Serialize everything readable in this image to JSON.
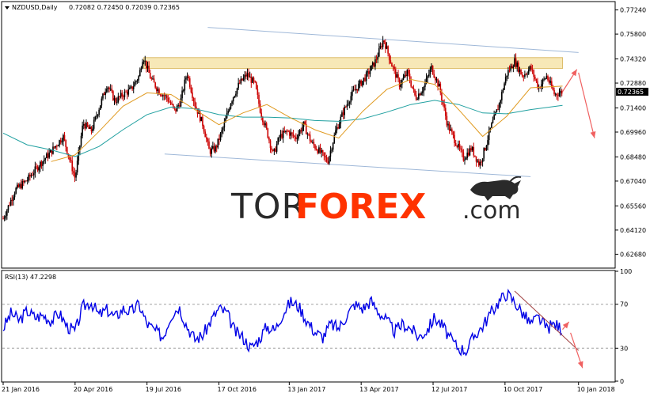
{
  "chart_data": [
    {
      "type": "candlestick",
      "title": "NZDUSD,Daily",
      "ohlc_values": "0.72082 0.72450 0.72039 0.72365",
      "last_price": "0.72365",
      "ylim": [
        0.619,
        0.7769
      ],
      "y_ticks": [
        "0.77240",
        "0.75800",
        "0.74320",
        "0.72880",
        "0.71400",
        "0.69960",
        "0.68480",
        "0.67040",
        "0.65560",
        "0.64120",
        "0.62680"
      ],
      "x_ticks": [
        "21 Jan 2016",
        "20 Apr 2016",
        "19 Jul 2016",
        "17 Oct 2016",
        "13 Jan 2017",
        "13 Apr 2017",
        "12 Jul 2017",
        "10 Oct 2017",
        "10 Jan 2018"
      ],
      "x_tick_days": [
        0,
        90,
        180,
        270,
        358,
        448,
        538,
        628,
        720
      ],
      "price_path": [
        [
          0,
          0.648
        ],
        [
          15,
          0.665
        ],
        [
          30,
          0.671
        ],
        [
          45,
          0.68
        ],
        [
          60,
          0.688
        ],
        [
          75,
          0.697
        ],
        [
          90,
          0.672
        ],
        [
          100,
          0.705
        ],
        [
          110,
          0.7
        ],
        [
          120,
          0.714
        ],
        [
          130,
          0.728
        ],
        [
          140,
          0.718
        ],
        [
          150,
          0.722
        ],
        [
          160,
          0.725
        ],
        [
          170,
          0.733
        ],
        [
          175,
          0.745
        ],
        [
          185,
          0.731
        ],
        [
          195,
          0.724
        ],
        [
          205,
          0.72
        ],
        [
          215,
          0.712
        ],
        [
          222,
          0.718
        ],
        [
          230,
          0.735
        ],
        [
          240,
          0.716
        ],
        [
          250,
          0.704
        ],
        [
          258,
          0.688
        ],
        [
          266,
          0.69
        ],
        [
          276,
          0.703
        ],
        [
          285,
          0.718
        ],
        [
          295,
          0.728
        ],
        [
          305,
          0.734
        ],
        [
          315,
          0.728
        ],
        [
          322,
          0.712
        ],
        [
          330,
          0.7
        ],
        [
          338,
          0.686
        ],
        [
          346,
          0.697
        ],
        [
          356,
          0.7
        ],
        [
          366,
          0.696
        ],
        [
          376,
          0.704
        ],
        [
          386,
          0.693
        ],
        [
          396,
          0.688
        ],
        [
          406,
          0.682
        ],
        [
          416,
          0.7
        ],
        [
          426,
          0.712
        ],
        [
          436,
          0.722
        ],
        [
          446,
          0.728
        ],
        [
          456,
          0.734
        ],
        [
          466,
          0.742
        ],
        [
          476,
          0.755
        ],
        [
          486,
          0.74
        ],
        [
          496,
          0.728
        ],
        [
          506,
          0.735
        ],
        [
          516,
          0.72
        ],
        [
          526,
          0.726
        ],
        [
          536,
          0.738
        ],
        [
          546,
          0.726
        ],
        [
          556,
          0.704
        ],
        [
          566,
          0.694
        ],
        [
          576,
          0.684
        ],
        [
          586,
          0.69
        ],
        [
          596,
          0.68
        ],
        [
          603,
          0.69
        ],
        [
          610,
          0.702
        ],
        [
          620,
          0.715
        ],
        [
          630,
          0.734
        ],
        [
          640,
          0.742
        ],
        [
          650,
          0.733
        ],
        [
          660,
          0.738
        ],
        [
          670,
          0.726
        ],
        [
          680,
          0.733
        ],
        [
          690,
          0.722
        ],
        [
          700,
          0.7237
        ]
      ],
      "ma_slow": [
        [
          0,
          0.699
        ],
        [
          30,
          0.692
        ],
        [
          60,
          0.689
        ],
        [
          90,
          0.685
        ],
        [
          120,
          0.691
        ],
        [
          150,
          0.701
        ],
        [
          180,
          0.71
        ],
        [
          210,
          0.7145
        ],
        [
          240,
          0.7135
        ],
        [
          270,
          0.71
        ],
        [
          300,
          0.7085
        ],
        [
          330,
          0.7085
        ],
        [
          360,
          0.708
        ],
        [
          390,
          0.7065
        ],
        [
          420,
          0.706
        ],
        [
          450,
          0.7075
        ],
        [
          480,
          0.7115
        ],
        [
          510,
          0.716
        ],
        [
          540,
          0.7185
        ],
        [
          570,
          0.716
        ],
        [
          600,
          0.711
        ],
        [
          630,
          0.7105
        ],
        [
          660,
          0.713
        ],
        [
          700,
          0.7155
        ]
      ],
      "ma_fast": [
        [
          60,
          0.682
        ],
        [
          90,
          0.686
        ],
        [
          120,
          0.7
        ],
        [
          150,
          0.715
        ],
        [
          180,
          0.723
        ],
        [
          210,
          0.722
        ],
        [
          240,
          0.713
        ],
        [
          270,
          0.704
        ],
        [
          300,
          0.711
        ],
        [
          330,
          0.716
        ],
        [
          360,
          0.708
        ],
        [
          390,
          0.701
        ],
        [
          420,
          0.696
        ],
        [
          450,
          0.712
        ],
        [
          480,
          0.725
        ],
        [
          510,
          0.731
        ],
        [
          540,
          0.728
        ],
        [
          570,
          0.713
        ],
        [
          600,
          0.697
        ],
        [
          630,
          0.709
        ],
        [
          660,
          0.726
        ],
        [
          700,
          0.727
        ]
      ],
      "resistance_zone": {
        "x": [
          176,
          700
        ],
        "y": [
          0.7375,
          0.744
        ]
      },
      "channel_upper": [
        [
          256,
          0.762
        ],
        [
          720,
          0.747
        ]
      ],
      "channel_lower": [
        [
          202,
          0.6865
        ],
        [
          660,
          0.673
        ]
      ],
      "forecast_arrows": [
        [
          [
            700,
            0.7237
          ],
          [
            718,
            0.737
          ]
        ],
        [
          [
            720,
            0.735
          ],
          [
            740,
            0.696
          ]
        ]
      ]
    },
    {
      "type": "line",
      "title": "RSI(13) 47.2298",
      "ylim": [
        0,
        100
      ],
      "y_ticks": [
        "100",
        "70",
        "30",
        "0"
      ],
      "level_lines": [
        70,
        30
      ],
      "rsi": [
        [
          0,
          48
        ],
        [
          10,
          62
        ],
        [
          20,
          55
        ],
        [
          30,
          64
        ],
        [
          40,
          58
        ],
        [
          50,
          60
        ],
        [
          60,
          55
        ],
        [
          70,
          62
        ],
        [
          80,
          50
        ],
        [
          90,
          45
        ],
        [
          100,
          68
        ],
        [
          110,
          72
        ],
        [
          120,
          60
        ],
        [
          130,
          65
        ],
        [
          140,
          58
        ],
        [
          150,
          66
        ],
        [
          160,
          63
        ],
        [
          170,
          70
        ],
        [
          180,
          52
        ],
        [
          190,
          46
        ],
        [
          200,
          40
        ],
        [
          210,
          60
        ],
        [
          220,
          68
        ],
        [
          230,
          50
        ],
        [
          240,
          38
        ],
        [
          250,
          42
        ],
        [
          260,
          55
        ],
        [
          270,
          66
        ],
        [
          280,
          62
        ],
        [
          290,
          45
        ],
        [
          300,
          40
        ],
        [
          310,
          30
        ],
        [
          320,
          38
        ],
        [
          330,
          50
        ],
        [
          340,
          46
        ],
        [
          350,
          62
        ],
        [
          360,
          72
        ],
        [
          370,
          68
        ],
        [
          380,
          55
        ],
        [
          390,
          45
        ],
        [
          400,
          40
        ],
        [
          410,
          52
        ],
        [
          420,
          48
        ],
        [
          430,
          60
        ],
        [
          440,
          70
        ],
        [
          450,
          66
        ],
        [
          460,
          73
        ],
        [
          470,
          63
        ],
        [
          480,
          55
        ],
        [
          490,
          45
        ],
        [
          500,
          52
        ],
        [
          510,
          48
        ],
        [
          520,
          40
        ],
        [
          530,
          46
        ],
        [
          540,
          58
        ],
        [
          550,
          50
        ],
        [
          560,
          38
        ],
        [
          570,
          30
        ],
        [
          580,
          28
        ],
        [
          590,
          42
        ],
        [
          600,
          50
        ],
        [
          610,
          62
        ],
        [
          620,
          72
        ],
        [
          630,
          80
        ],
        [
          640,
          72
        ],
        [
          650,
          62
        ],
        [
          660,
          52
        ],
        [
          670,
          58
        ],
        [
          680,
          48
        ],
        [
          690,
          52
        ],
        [
          700,
          47.2
        ]
      ],
      "trendline": [
        [
          640,
          82
        ],
        [
          720,
          28
        ]
      ],
      "forecast_arrows": [
        [
          [
            700,
            47
          ],
          [
            708,
            54
          ]
        ],
        [
          [
            710,
            44
          ],
          [
            725,
            12
          ]
        ]
      ]
    }
  ],
  "watermark": {
    "part1": "TOR",
    "part2": "FOREX",
    "part3": ".com"
  },
  "colors": {
    "bull": "#000000",
    "bear": "#cc0000",
    "ma_slow": "#20a0a0",
    "ma_fast": "#e09a20",
    "zone_fill": "#f7e6b0",
    "zone_stroke": "#d9b55a",
    "channel": "#9fb8d8",
    "rsi": "#0000e6",
    "arrow": "#f06060",
    "rsi_trend": "#a04040"
  }
}
